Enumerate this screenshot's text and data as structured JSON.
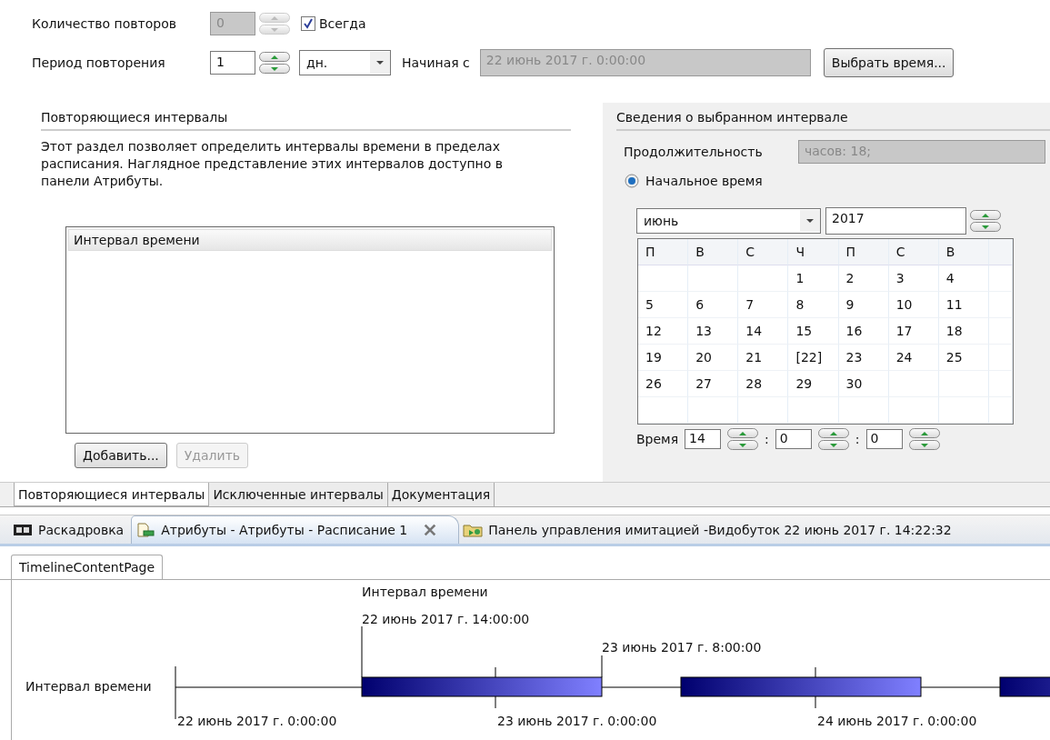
{
  "repeat_count": {
    "label": "Количество повторов",
    "value": "0",
    "disabled": true
  },
  "always": {
    "label": "Всегда",
    "checked": true
  },
  "period": {
    "label": "Период повторения",
    "value": "1",
    "unit": "дн.",
    "start_label": "Начиная с",
    "start_value": "22 июнь 2017 г. 0:00:00",
    "start_disabled": true,
    "choose_button": "Выбрать время..."
  },
  "intervals_section": {
    "title": "Повторяющиеся интервалы",
    "description": "Этот раздел позволяет определить интервалы времени в пределах расписания. Наглядное представление этих интервалов доступно в панели Атрибуты.",
    "list_header": "Интервал времени",
    "buttons": [
      {
        "label": "Добавить...",
        "disabled": false
      },
      {
        "label": "Удалить",
        "disabled": true
      }
    ]
  },
  "details": {
    "title": "Сведения о выбранном интервале",
    "duration_label": "Продолжительность",
    "duration_value": "часов: 18;",
    "start_radio": {
      "label": "Начальное время",
      "selected": true
    },
    "month": "июнь",
    "year": "2017",
    "weekdays": [
      "П",
      "В",
      "С",
      "Ч",
      "П",
      "С",
      "В"
    ],
    "weeks": [
      {
        "days": [
          "1",
          "2",
          "3",
          "4"
        ]
      },
      {
        "days": [
          "5",
          "6",
          "7",
          "8",
          "9",
          "10",
          "11"
        ]
      },
      {
        "days": [
          "12",
          "13",
          "14",
          "15",
          "16",
          "17",
          "18"
        ]
      },
      {
        "days": [
          "19",
          "20",
          "21",
          "[22]",
          "23",
          "24",
          "25"
        ]
      },
      {
        "days": [
          "26",
          "27",
          "28",
          "29",
          "30"
        ]
      }
    ],
    "time_label": "Время",
    "time_values": [
      "14",
      "0",
      "0"
    ],
    "time_separator": ":"
  },
  "section_tabs": [
    {
      "label": "Повторяющиеся интервалы",
      "selected": true
    },
    {
      "label": "Исключенные интервалы",
      "selected": false
    },
    {
      "label": "Документация",
      "selected": false
    }
  ],
  "editor_tabs": [
    {
      "label": "Раскадровка",
      "selected": false
    },
    {
      "label": "Атрибуты - Атрибуты - Расписание 1",
      "selected": true
    },
    {
      "label": "Панель управления имитацией -Видобуток 22 июнь 2017 г. 14:22:32",
      "selected": false
    }
  ],
  "content_tab": {
    "label": "TimelineContentPage"
  },
  "timeline": {
    "row_label": "Интервал времени",
    "bars": [
      {
        "kind": "labeled",
        "title": "Интервал времени",
        "start": "22 июнь 2017 г. 14:00:00",
        "end": "23 июнь 2017 г. 8:00:00"
      },
      {
        "kind": "plain"
      },
      {
        "kind": "plain"
      }
    ],
    "axis_labels": [
      "22 июнь 2017 г. 0:00:00",
      "23 июнь 2017 г. 0:00:00",
      "24 июнь 2017 г. 0:00:00"
    ]
  }
}
